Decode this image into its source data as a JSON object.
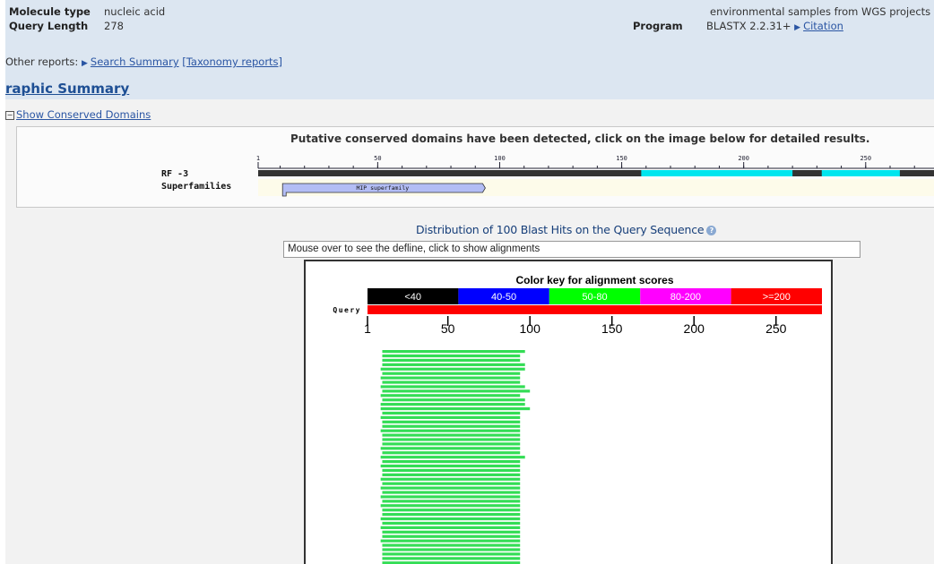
{
  "header": {
    "molecule_type_label": "Molecule type",
    "molecule_type_value": "nucleic acid",
    "query_length_label": "Query Length",
    "query_length_value": "278",
    "database_value": "environmental samples from WGS projects",
    "program_label": "Program",
    "program_value": "BLASTX 2.2.31+",
    "citation_link": "Citation"
  },
  "other_reports": {
    "label": "Other reports:",
    "search_summary_link": "Search Summary",
    "taxonomy_link": "[Taxonomy reports]"
  },
  "graphic_summary": {
    "title": "raphic Summary",
    "show_conserved_domains": "Show Conserved Domains"
  },
  "conserved_domains": {
    "message": "Putative conserved domains have been detected, click on the image below for detailed results.",
    "frame_label": "RF -3",
    "superfamilies_label": "Superfamilies",
    "superfamily_name": "MIP superfamily",
    "ruler_ticks": [
      "1",
      "50",
      "100",
      "150",
      "200",
      "250"
    ],
    "ruler_tick_values": [
      1,
      50,
      100,
      150,
      200,
      250
    ],
    "query_length": 278,
    "domain_range": [
      11,
      93
    ],
    "hit_segments": [
      [
        158,
        220
      ],
      [
        232,
        264
      ]
    ],
    "colors": {
      "bar_dark": "#333333",
      "bar_hit": "#00e5ee",
      "domain_fill": "#b3bdf5",
      "band": "#fdfbea"
    }
  },
  "distribution": {
    "title": "Distribution of 100 Blast Hits on the Query Sequence",
    "defline_placeholder": "Mouse over to see the defline, click to show alignments",
    "color_key_title": "Color key for alignment scores",
    "query_label": "Query",
    "axis_ticks": [
      "1",
      "50",
      "100",
      "150",
      "200",
      "250"
    ],
    "axis_tick_values": [
      1,
      50,
      100,
      150,
      200,
      250
    ],
    "query_length": 278,
    "color_key": [
      {
        "label": "<40",
        "color": "#000000"
      },
      {
        "label": "40-50",
        "color": "#0000ff"
      },
      {
        "label": "50-80",
        "color": "#00ff00"
      },
      {
        "label": "80-200",
        "color": "#ff00ff"
      },
      {
        "label": ">=200",
        "color": "#ff0000"
      }
    ],
    "hit_color": "#33dd55",
    "query_bar_color": "#ff0000",
    "hits": [
      [
        10,
        97
      ],
      [
        10,
        94
      ],
      [
        10,
        94
      ],
      [
        10,
        97
      ],
      [
        9,
        97
      ],
      [
        10,
        94
      ],
      [
        9,
        94
      ],
      [
        10,
        94
      ],
      [
        9,
        97
      ],
      [
        10,
        100
      ],
      [
        9,
        94
      ],
      [
        10,
        97
      ],
      [
        9,
        97
      ],
      [
        9,
        100
      ],
      [
        10,
        94
      ],
      [
        9,
        94
      ],
      [
        10,
        94
      ],
      [
        10,
        94
      ],
      [
        9,
        94
      ],
      [
        10,
        94
      ],
      [
        10,
        94
      ],
      [
        10,
        94
      ],
      [
        9,
        94
      ],
      [
        10,
        94
      ],
      [
        9,
        97
      ],
      [
        10,
        94
      ],
      [
        9,
        94
      ],
      [
        10,
        94
      ],
      [
        10,
        94
      ],
      [
        9,
        94
      ],
      [
        10,
        94
      ],
      [
        9,
        94
      ],
      [
        10,
        94
      ],
      [
        9,
        94
      ],
      [
        10,
        94
      ],
      [
        9,
        94
      ],
      [
        10,
        94
      ],
      [
        10,
        94
      ],
      [
        9,
        94
      ],
      [
        10,
        94
      ],
      [
        9,
        94
      ],
      [
        10,
        94
      ],
      [
        10,
        94
      ],
      [
        9,
        94
      ],
      [
        10,
        94
      ],
      [
        10,
        94
      ],
      [
        10,
        94
      ],
      [
        10,
        94
      ],
      [
        10,
        94
      ],
      [
        10,
        94
      ],
      [
        10,
        94
      ],
      [
        10,
        94
      ],
      [
        10,
        94
      ]
    ]
  }
}
